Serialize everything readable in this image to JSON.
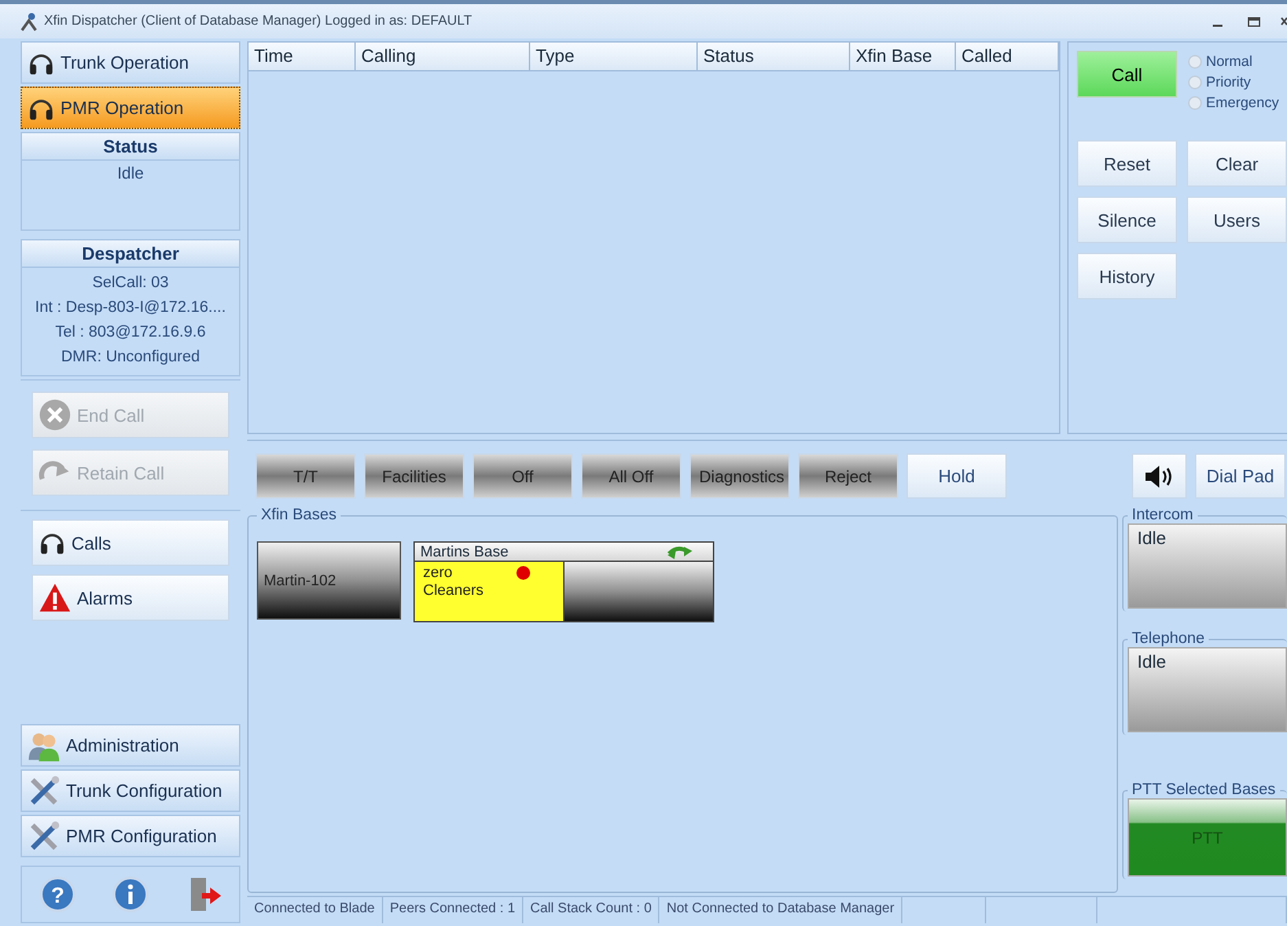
{
  "window": {
    "title": "Xfin Dispatcher (Client of Database Manager) Logged in as: DEFAULT"
  },
  "sidebar": {
    "modes": [
      {
        "label": "Trunk Operation",
        "selected": false
      },
      {
        "label": "PMR Operation",
        "selected": true
      }
    ],
    "status": {
      "heading": "Status",
      "value": "Idle"
    },
    "despatcher": {
      "heading": "Despatcher",
      "lines": [
        "SelCall: 03",
        "Int : Desp-803-I@172.16....",
        "Tel : 803@172.16.9.6",
        "DMR: Unconfigured"
      ]
    },
    "call_actions": [
      {
        "label": "End Call",
        "kind": "end",
        "disabled": true
      },
      {
        "label": "Retain Call",
        "kind": "retain",
        "disabled": true
      }
    ],
    "views": [
      {
        "label": "Calls",
        "kind": "headset"
      },
      {
        "label": "Alarms",
        "kind": "alarm"
      }
    ],
    "config": [
      {
        "label": "Administration",
        "kind": "people"
      },
      {
        "label": "Trunk Configuration",
        "kind": "tools"
      },
      {
        "label": "PMR Configuration",
        "kind": "tools"
      }
    ],
    "footer_icons": [
      {
        "kind": "help",
        "glyph": "?"
      },
      {
        "kind": "info"
      },
      {
        "kind": "exit"
      }
    ]
  },
  "call_table": {
    "columns": [
      "Time",
      "Calling",
      "Type",
      "Status",
      "Xfin Base",
      "Called"
    ]
  },
  "call_panel": {
    "call_button": "Call",
    "priorities": [
      {
        "label": "Normal",
        "selected": false
      },
      {
        "label": "Priority",
        "selected": false
      },
      {
        "label": "Emergency",
        "selected": false
      }
    ],
    "buttons": [
      "Reset",
      "Clear",
      "Silence",
      "Users",
      "History"
    ]
  },
  "toolbar": {
    "buttons": [
      {
        "label": "T/T",
        "kind": "dark"
      },
      {
        "label": "Facilities",
        "kind": "dark"
      },
      {
        "label": "Off",
        "kind": "dark"
      },
      {
        "label": "All Off",
        "kind": "dark"
      },
      {
        "label": "Diagnostics",
        "kind": "dark"
      },
      {
        "label": "Reject",
        "kind": "dark"
      },
      {
        "label": "Hold",
        "kind": "light"
      }
    ],
    "dial_pad": "Dial Pad"
  },
  "xfin_bases": {
    "legend": "Xfin Bases",
    "bases": [
      {
        "kind": "single",
        "name": "Martin-102"
      },
      {
        "kind": "group",
        "name": "Martins Base",
        "slots": [
          {
            "active": true,
            "lines": [
              "zero",
              "Cleaners"
            ]
          },
          {
            "active": false
          }
        ]
      }
    ]
  },
  "intercom": {
    "legend": "Intercom",
    "status": "Idle"
  },
  "telephone": {
    "legend": "Telephone",
    "status": "Idle"
  },
  "ptt": {
    "legend": "PTT Selected Bases",
    "button": "PTT"
  },
  "status_bar": [
    "Connected to Blade",
    "Peers Connected : 1",
    "Call Stack Count : 0",
    "Not Connected to Database Manager"
  ]
}
